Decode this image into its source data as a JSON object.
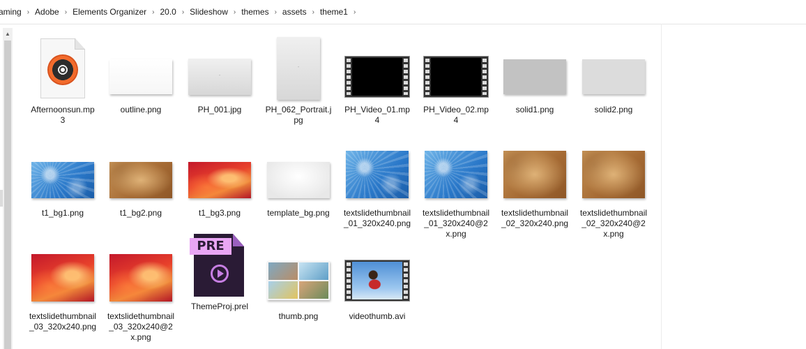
{
  "breadcrumb": [
    "aming",
    "Adobe",
    "Elements Organizer",
    "20.0",
    "Slideshow",
    "themes",
    "assets",
    "theme1"
  ],
  "breadcrumb_separator": "›",
  "files": [
    {
      "name": "Afternoonsun.mp3",
      "icon": "audio-file-icon"
    },
    {
      "name": "outline.png",
      "icon": "image-thumbnail"
    },
    {
      "name": "PH_001.jpg",
      "icon": "image-thumbnail"
    },
    {
      "name": "PH_062_Portrait.jpg",
      "icon": "image-thumbnail"
    },
    {
      "name": "PH_Video_01.mp4",
      "icon": "video-thumbnail"
    },
    {
      "name": "PH_Video_02.mp4",
      "icon": "video-thumbnail"
    },
    {
      "name": "solid1.png",
      "icon": "image-thumbnail"
    },
    {
      "name": "solid2.png",
      "icon": "image-thumbnail"
    },
    {
      "name": "t1_bg1.png",
      "icon": "image-thumbnail"
    },
    {
      "name": "t1_bg2.png",
      "icon": "image-thumbnail"
    },
    {
      "name": "t1_bg3.png",
      "icon": "image-thumbnail"
    },
    {
      "name": "template_bg.png",
      "icon": "image-thumbnail"
    },
    {
      "name": "textslidethumbnail_01_320x240.png",
      "icon": "image-thumbnail"
    },
    {
      "name": "textslidethumbnail_01_320x240@2x.png",
      "icon": "image-thumbnail"
    },
    {
      "name": "textslidethumbnail_02_320x240.png",
      "icon": "image-thumbnail"
    },
    {
      "name": "textslidethumbnail_02_320x240@2x.png",
      "icon": "image-thumbnail"
    },
    {
      "name": "textslidethumbnail_03_320x240.png",
      "icon": "image-thumbnail"
    },
    {
      "name": "textslidethumbnail_03_320x240@2x.png",
      "icon": "image-thumbnail"
    },
    {
      "name": "ThemeProj.prel",
      "icon": "premiere-elements-project-icon"
    },
    {
      "name": "thumb.png",
      "icon": "image-thumbnail"
    },
    {
      "name": "videothumb.avi",
      "icon": "video-thumbnail"
    }
  ],
  "pre_icon_text": "PRE"
}
